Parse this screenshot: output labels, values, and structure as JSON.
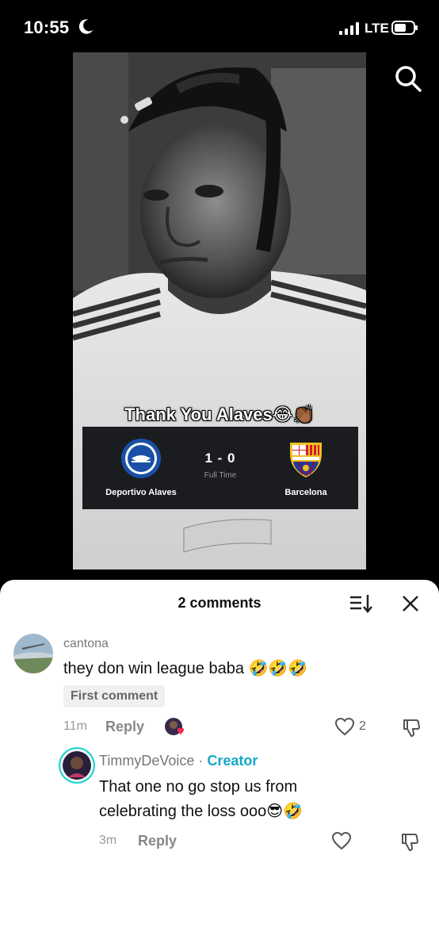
{
  "status_bar": {
    "time": "10:55",
    "network": "LTE"
  },
  "video": {
    "caption": "Thank You Alaves😂👏🏾",
    "scoreboard": {
      "home_team": "Deportivo Alaves",
      "away_team": "Barcelona",
      "score": "1 - 0",
      "status": "Full Time"
    }
  },
  "comments_sheet": {
    "title": "2 comments",
    "comments": [
      {
        "username": "cantona",
        "text": "they don win league baba 🤣🤣🤣",
        "badge": "First comment",
        "time": "11m",
        "reply_label": "Reply",
        "likes": "2"
      },
      {
        "username": "TimmyDeVoice",
        "separator": " · ",
        "creator_label": "Creator",
        "text": "That one no go stop us from celebrating the loss ooo😎🤣",
        "time": "3m",
        "reply_label": "Reply"
      }
    ]
  },
  "colors": {
    "creator": "#15a8c9",
    "sheet_bg": "#ffffff",
    "like_heart": "#fe2c55"
  }
}
